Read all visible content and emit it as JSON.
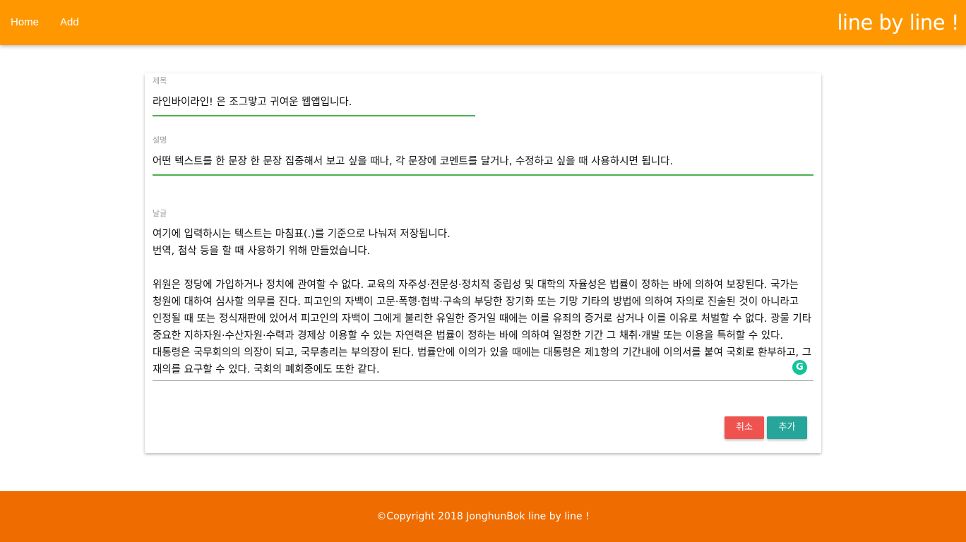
{
  "colors": {
    "navbar": "#ff9800",
    "footer": "#ef6c00",
    "active_underline": "#4caf50",
    "cancel_button": "#ef5350",
    "add_button": "#26a69a",
    "grammar_icon": "#15c39a"
  },
  "nav": {
    "home_label": "Home",
    "add_label": "Add",
    "brand": "line by line !"
  },
  "form": {
    "title_label": "제목",
    "title_value": "라인바이라인! 은 조그맣고 귀여운 웹앱입니다.",
    "description_label": "설명",
    "description_value": "어떤 텍스트를 한 문장 한 문장 집중해서 보고 싶을 때나, 각 문장에 코멘트를 달거나, 수정하고 싶을 때 사용하시면 됩니다.",
    "body_label": "날글",
    "body_value": "여기에 입력하시는 텍스트는 마침표(.)를 기준으로 나눠져 저장됩니다.\n번역, 첨삭 등을 할 때 사용하기 위해 만들었습니다.\n\n위원은 정당에 가입하거나 정치에 관여할 수 없다. 교육의 자주성·전문성·정치적 중립성 및 대학의 자율성은 법률이 정하는 바에 의하여 보장된다. 국가는 청원에 대하여 심사할 의무를 진다. 피고인의 자백이 고문·폭행·협박·구속의 부당한 장기화 또는 기망 기타의 방법에 의하여 자의로 진술된 것이 아니라고 인정될 때 또는 정식재판에 있어서 피고인의 자백이 그에게 불리한 유일한 증거일 때에는 이를 유죄의 증거로 삼거나 이를 이유로 처벌할 수 없다. 광물 기타 중요한 지하자원·수산자원·수력과 경제상 이용할 수 있는 자연력은 법률이 정하는 바에 의하여 일정한 기간 그 채취·개발 또는 이용을 특허할 수 있다. 대통령은 국무회의의 의장이 되고, 국무총리는 부의장이 된다. 법률안에 이의가 있을 때에는 대통령은 제1항의 기간내에 이의서를 붙여 국회로 환부하고, 그 재의를 요구할 수 있다. 국회의 폐회중에도 또한 같다.",
    "grammar_icon_glyph": "G",
    "cancel_label": "취소",
    "add_label": "추가"
  },
  "footer": {
    "text": "©Copyright 2018 JonghunBok line by line !"
  }
}
